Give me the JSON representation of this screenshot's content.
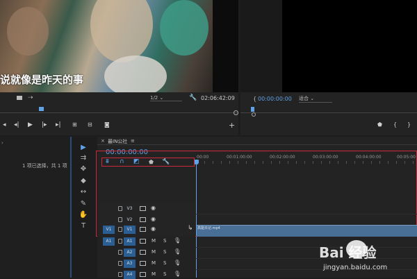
{
  "source_monitor": {
    "subtitle": "说就像是昨天的事",
    "zoom": "1/2",
    "timecode": "02:06:42:09"
  },
  "program_monitor": {
    "timecode": "00:00:00:00",
    "fit": "适合"
  },
  "project": {
    "status": "1 项已选择，共 1 项"
  },
  "timeline": {
    "tab_name": "最IN公社",
    "timecode": "00:00:00:00",
    "ruler": [
      "00:00",
      "00:01:00:00",
      "00:02:00:00",
      "00:03:00:00",
      "00:04:00:00",
      "00:05:00"
    ],
    "video_tracks": [
      "V3",
      "V2",
      "V1"
    ],
    "audio_tracks": [
      "A1",
      "A2",
      "A3",
      "A4"
    ],
    "source_video": "V1",
    "source_audio": "A1",
    "clip_name": "高能日记.mp4",
    "mute": "M",
    "solo": "S"
  },
  "watermark": {
    "brand": "Bai 经验",
    "url": "jingyan.baidu.com"
  },
  "colors": {
    "accent": "#5fa2e8",
    "highlight": "#d0283c",
    "clip": "#4a6f96"
  }
}
